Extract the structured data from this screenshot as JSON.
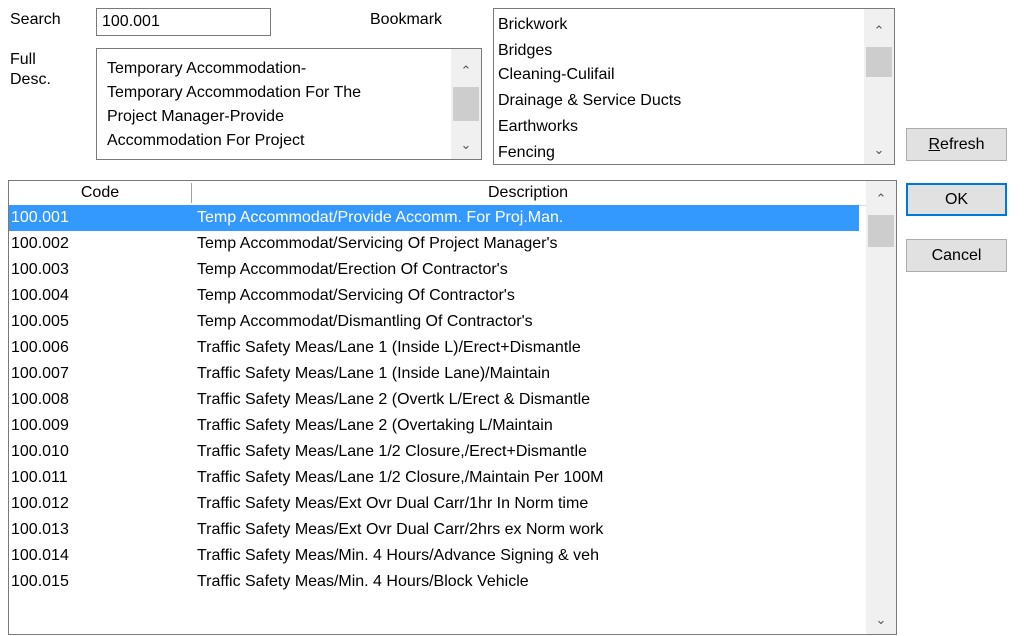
{
  "search": {
    "label": "Search",
    "value": "100.001"
  },
  "bookmark": {
    "label": "Bookmark",
    "items": [
      "Brickwork",
      "Bridges",
      "Cleaning-Culifail",
      "Drainage & Service Ducts",
      "Earthworks",
      "Fencing"
    ]
  },
  "full_desc": {
    "label_line1": "Full",
    "label_line2": "Desc.",
    "lines": [
      "Temporary Accommodation-",
      "Temporary Accommodation For The",
      "Project Manager-Provide",
      "Accommodation For Project"
    ]
  },
  "buttons": {
    "refresh": "Refresh",
    "ok": "OK",
    "cancel": "Cancel"
  },
  "grid": {
    "columns": [
      "Code",
      "Description"
    ],
    "selected_index": 0,
    "rows": [
      {
        "code": "100.001",
        "description": "Temp Accommodat/Provide Accomm. For Proj.Man."
      },
      {
        "code": "100.002",
        "description": "Temp Accommodat/Servicing Of Project Manager's"
      },
      {
        "code": "100.003",
        "description": "Temp Accommodat/Erection Of Contractor's"
      },
      {
        "code": "100.004",
        "description": "Temp Accommodat/Servicing Of Contractor's"
      },
      {
        "code": "100.005",
        "description": "Temp Accommodat/Dismantling Of Contractor's"
      },
      {
        "code": "100.006",
        "description": "Traffic Safety Meas/Lane 1 (Inside L)/Erect+Dismantle"
      },
      {
        "code": "100.007",
        "description": "Traffic Safety Meas/Lane 1 (Inside Lane)/Maintain"
      },
      {
        "code": "100.008",
        "description": "Traffic Safety Meas/Lane 2 (Overtk L/Erect & Dismantle"
      },
      {
        "code": "100.009",
        "description": "Traffic Safety Meas/Lane 2 (Overtaking L/Maintain"
      },
      {
        "code": "100.010",
        "description": "Traffic Safety Meas/Lane 1/2 Closure,/Erect+Dismantle"
      },
      {
        "code": "100.011",
        "description": "Traffic Safety Meas/Lane 1/2 Closure,/Maintain Per 100M"
      },
      {
        "code": "100.012",
        "description": "Traffic Safety Meas/Ext Ovr Dual Carr/1hr In Norm time"
      },
      {
        "code": "100.013",
        "description": "Traffic Safety Meas/Ext Ovr Dual Carr/2hrs ex Norm work"
      },
      {
        "code": "100.014",
        "description": "Traffic Safety Meas/Min. 4 Hours/Advance Signing & veh"
      },
      {
        "code": "100.015",
        "description": "Traffic Safety Meas/Min. 4 Hours/Block Vehicle"
      }
    ]
  },
  "icons": {
    "scroll_up": "chevron-up-icon",
    "scroll_down": "chevron-down-icon"
  },
  "colors": {
    "selection": "#3399ff",
    "default_button_border": "#0078d7",
    "button_face": "#e1e1e1"
  }
}
